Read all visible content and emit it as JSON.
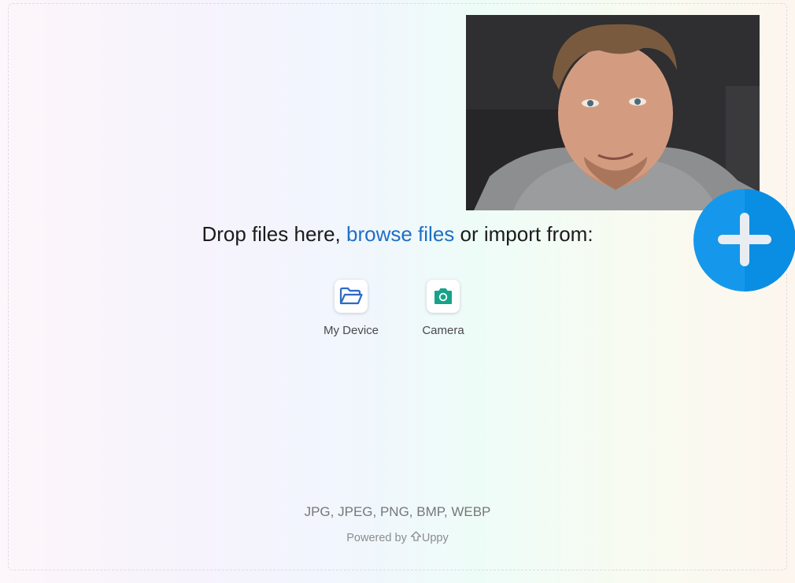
{
  "dropzone": {
    "text_before": "Drop files here,",
    "browse_link": "browse files",
    "text_after": "or import from:"
  },
  "sources": [
    {
      "label": "My Device",
      "icon": "folder-icon"
    },
    {
      "label": "Camera",
      "icon": "camera-icon"
    }
  ],
  "formats": "JPG, JPEG, PNG, BMP, WEBP",
  "footer": {
    "powered_by": "Powered by",
    "brand": "Uppy",
    "brand_icon": "uppy-logo-icon"
  },
  "preview": {
    "image": "selfie-photo"
  },
  "fab": {
    "icon": "plus-icon",
    "color": "#1598ec"
  },
  "colors": {
    "link": "#1f6fc5",
    "device_icon": "#2d6bc4",
    "camera_icon": "#16a38a"
  }
}
